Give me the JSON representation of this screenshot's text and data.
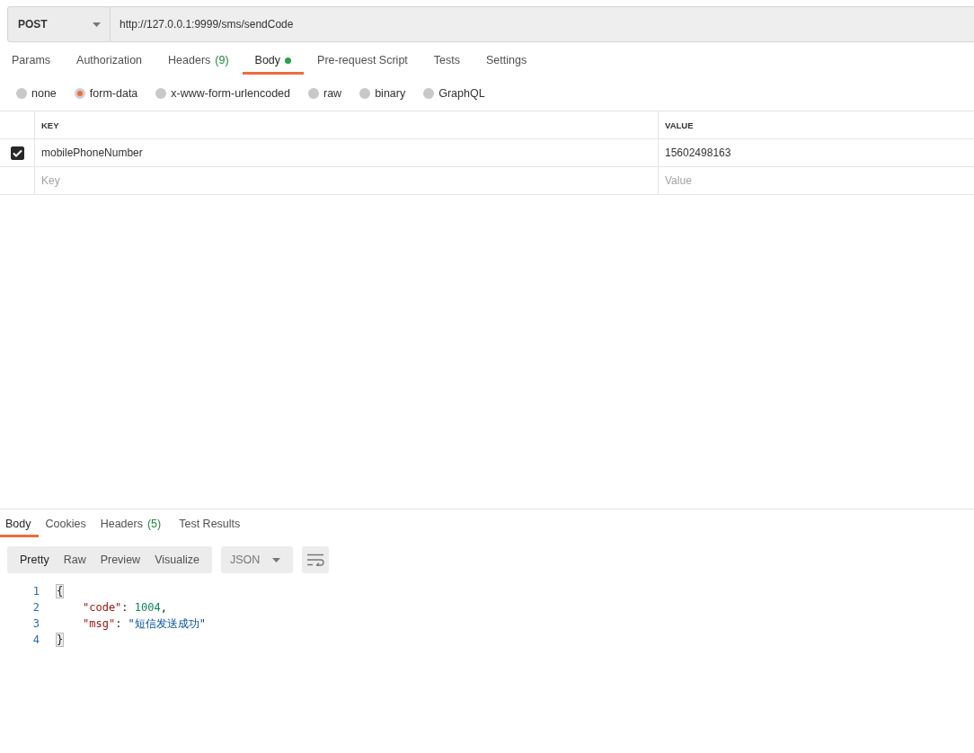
{
  "request": {
    "method": "POST",
    "url": "http://127.0.0.1:9999/sms/sendCode"
  },
  "tabs": [
    {
      "label": "Params",
      "dot": false,
      "selected": false
    },
    {
      "label": "Authorization",
      "dot": false,
      "selected": false
    },
    {
      "label": "Headers",
      "count": "(9)",
      "dot": false,
      "selected": false
    },
    {
      "label": "Body",
      "dot": true,
      "selected": true
    },
    {
      "label": "Pre-request Script",
      "dot": false,
      "selected": false
    },
    {
      "label": "Tests",
      "dot": false,
      "selected": false
    },
    {
      "label": "Settings",
      "dot": false,
      "selected": false
    }
  ],
  "body_types": [
    {
      "label": "none",
      "selected": false
    },
    {
      "label": "form-data",
      "selected": true
    },
    {
      "label": "x-www-form-urlencoded",
      "selected": false
    },
    {
      "label": "raw",
      "selected": false
    },
    {
      "label": "binary",
      "selected": false
    },
    {
      "label": "GraphQL",
      "selected": false
    }
  ],
  "params_table": {
    "columns": [
      "KEY",
      "VALUE"
    ],
    "rows": [
      {
        "checked": true,
        "key": "mobilePhoneNumber",
        "value": "15602498163"
      }
    ],
    "new_row": {
      "key_placeholder": "Key",
      "value_placeholder": "Value"
    }
  },
  "response_tabs": [
    {
      "label": "Body",
      "selected": true
    },
    {
      "label": "Cookies",
      "selected": false
    },
    {
      "label": "Headers",
      "count": "(5)",
      "selected": false
    },
    {
      "label": "Test Results",
      "selected": false
    }
  ],
  "view_modes": [
    {
      "label": "Pretty",
      "selected": true
    },
    {
      "label": "Raw",
      "selected": false
    },
    {
      "label": "Preview",
      "selected": false
    },
    {
      "label": "Visualize",
      "selected": false
    }
  ],
  "format": "JSON",
  "code": [
    {
      "number": "1",
      "tokens": [
        {
          "kind": "bracket",
          "text": "{"
        }
      ],
      "children": [
        {
          "number": "2",
          "tokens": [
            {
              "kind": "key",
              "text": "\"code\""
            },
            {
              "kind": "punct",
              "text": ": "
            },
            {
              "kind": "number",
              "text": "1004"
            },
            {
              "kind": "punct",
              "text": ","
            }
          ]
        },
        {
          "number": "3",
          "tokens": [
            {
              "kind": "key",
              "text": "\"msg\""
            },
            {
              "kind": "punct",
              "text": ": "
            },
            {
              "kind": "string",
              "text": "\"短信发送成功\""
            }
          ]
        }
      ]
    },
    {
      "number": "4",
      "tokens": [
        {
          "kind": "bracket",
          "text": "}"
        }
      ]
    }
  ]
}
